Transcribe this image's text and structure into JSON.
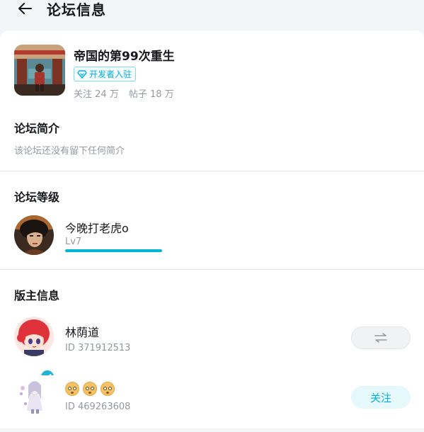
{
  "header": {
    "title": "论坛信息"
  },
  "forum": {
    "name": "帝国的第99次重生",
    "badge": "开发者入驻",
    "followers": "关注 24 万",
    "posts": "帖子 18 万"
  },
  "intro": {
    "title": "论坛简介",
    "text": "该论坛还没有留下任何简介"
  },
  "level": {
    "title": "论坛等级",
    "user": {
      "name": "今晚打老虎o",
      "level": "Lv7",
      "progress": 1.0
    }
  },
  "moderators": {
    "title": "版主信息",
    "list": [
      {
        "name": "林荫道",
        "id": "ID 371912513",
        "action": "⇌"
      },
      {
        "name": "",
        "id": "ID 469263608",
        "action": "关注"
      }
    ]
  },
  "colors": {
    "accent": "#00aeec",
    "level_bar": "#00b5d1",
    "verify": "#1fb6d3"
  }
}
